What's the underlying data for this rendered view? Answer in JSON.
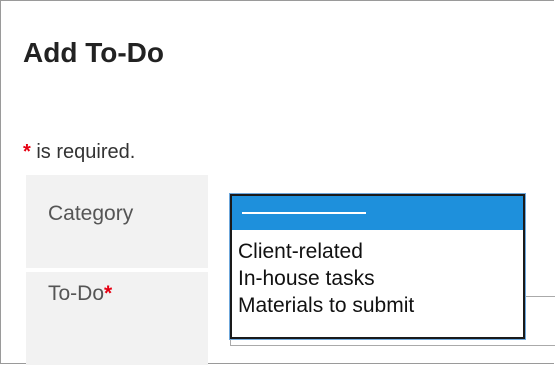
{
  "page": {
    "title": "Add To-Do",
    "required_asterisk": "*",
    "required_note": " is required."
  },
  "form": {
    "category_label": "Category",
    "todo_label": "To-Do",
    "todo_required_mark": "*",
    "todo_value": ""
  },
  "category_dropdown": {
    "selected_option": "----------------",
    "options": [
      "Client-related",
      "In-house tasks",
      "Materials to submit"
    ]
  },
  "colors": {
    "asterisk": "#e60012",
    "selected_option_bg": "#1e90dc",
    "label_cell_bg": "#f2f2f2"
  }
}
